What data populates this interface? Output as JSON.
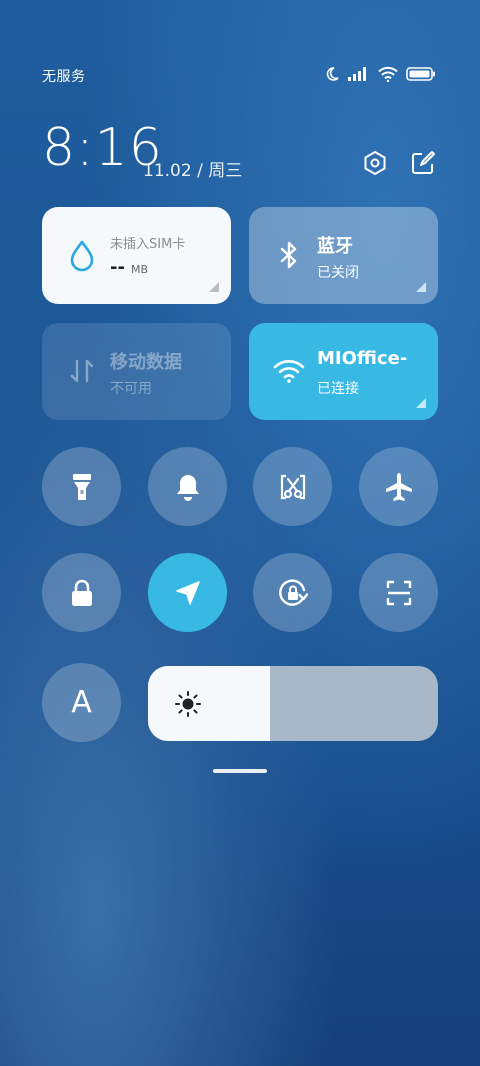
{
  "status_bar": {
    "carrier": "无服务",
    "icons": [
      "moon-icon",
      "signal-icon",
      "wifi-icon",
      "battery-icon"
    ]
  },
  "header": {
    "time": "8:16",
    "date": "11.02 / 周三",
    "actions": [
      "settings-icon",
      "edit-icon"
    ]
  },
  "tiles": {
    "data_usage": {
      "title": "未插入SIM卡",
      "value": "--",
      "unit": "MB",
      "icon": "water-drop-icon"
    },
    "bluetooth": {
      "title": "蓝牙",
      "status": "已关闭",
      "icon": "bluetooth-icon"
    },
    "mobile_data": {
      "title": "移动数据",
      "status": "不可用",
      "icon": "data-arrows-icon"
    },
    "wifi": {
      "title": "MIOffice-",
      "status": "已连接",
      "icon": "wifi-icon"
    }
  },
  "toggles": [
    {
      "name": "flashlight",
      "icon": "flashlight-icon",
      "on": false
    },
    {
      "name": "ring",
      "icon": "bell-icon",
      "on": false
    },
    {
      "name": "screenshot",
      "icon": "screenshot-scissors-icon",
      "on": false
    },
    {
      "name": "airplane",
      "icon": "airplane-icon",
      "on": false
    },
    {
      "name": "lock",
      "icon": "lock-icon",
      "on": false
    },
    {
      "name": "location",
      "icon": "location-arrow-icon",
      "on": true
    },
    {
      "name": "rotation-lock",
      "icon": "rotation-lock-icon",
      "on": false
    },
    {
      "name": "scanner",
      "icon": "scan-icon",
      "on": false
    },
    {
      "name": "font-size",
      "icon": "letter-a-icon",
      "label": "A",
      "on": false
    }
  ],
  "brightness": {
    "level": 0.42,
    "icon": "sun-icon"
  },
  "colors": {
    "accent": "#37b9e4"
  }
}
